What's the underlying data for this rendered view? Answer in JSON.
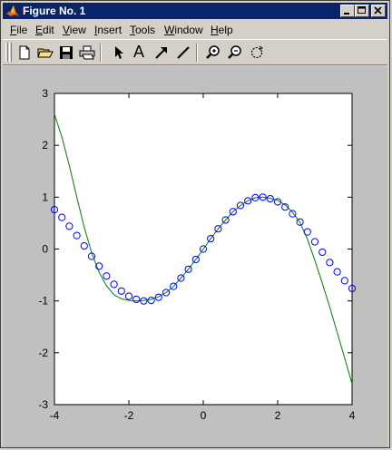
{
  "window": {
    "title": "Figure No. 1"
  },
  "menu": {
    "items": [
      {
        "label": "File",
        "underline": "F",
        "rest": "ile"
      },
      {
        "label": "Edit",
        "underline": "E",
        "rest": "dit"
      },
      {
        "label": "View",
        "underline": "V",
        "rest": "iew"
      },
      {
        "label": "Insert",
        "underline": "I",
        "rest": "nsert"
      },
      {
        "label": "Tools",
        "underline": "T",
        "rest": "ools"
      },
      {
        "label": "Window",
        "underline": "W",
        "rest": "indow"
      },
      {
        "label": "Help",
        "underline": "H",
        "rest": "elp"
      }
    ]
  },
  "toolbar": {
    "tools": [
      "new-file-icon",
      "open-folder-icon",
      "save-icon",
      "print-icon",
      "select-arrow-icon",
      "insert-text-icon",
      "insert-arrow-icon",
      "insert-line-icon",
      "zoom-in-icon",
      "zoom-out-icon",
      "rotate-3d-icon"
    ],
    "text_tool_glyph": "A"
  },
  "colors": {
    "titlebar": "#0a246a",
    "curve": "#008000",
    "markers": "#0000ff",
    "figure_bg": "#c0c0c0",
    "axes_bg": "#ffffff"
  },
  "chart_data": {
    "type": "line",
    "title": "",
    "xlabel": "",
    "ylabel": "",
    "xlim": [
      -4,
      4
    ],
    "ylim": [
      -3,
      3
    ],
    "xticks": [
      "-4",
      "-2",
      "0",
      "2",
      "4"
    ],
    "yticks": [
      "-3",
      "-2",
      "-1",
      "0",
      "1",
      "2",
      "3"
    ],
    "grid": false,
    "series": [
      {
        "style": "solid-line",
        "color": "#008000",
        "x": [
          -4,
          -3.8,
          -3.6,
          -3.4,
          -3.2,
          -3,
          -2.8,
          -2.6,
          -2.4,
          -2.2,
          -2,
          -1.8,
          -1.6,
          -1.4,
          -1.2,
          -1,
          -0.8,
          -0.6,
          -0.4,
          -0.2,
          0,
          0.2,
          0.4,
          0.6,
          0.8,
          1,
          1.2,
          1.4,
          1.6,
          1.8,
          2,
          2.2,
          2.4,
          2.6,
          2.8,
          3,
          3.2,
          3.4,
          3.6,
          3.8,
          4
        ],
        "y": [
          2.6,
          2.16,
          1.61,
          1.0,
          0.42,
          -0.07,
          -0.45,
          -0.71,
          -0.88,
          -0.96,
          -0.99,
          -1.0,
          -0.99,
          -0.97,
          -0.92,
          -0.84,
          -0.72,
          -0.56,
          -0.39,
          -0.2,
          0.0,
          0.2,
          0.39,
          0.56,
          0.72,
          0.84,
          0.93,
          0.99,
          1.0,
          0.98,
          0.94,
          0.85,
          0.71,
          0.51,
          0.19,
          -0.22,
          -0.66,
          -1.12,
          -1.61,
          -2.1,
          -2.6
        ]
      },
      {
        "style": "circle-markers",
        "color": "#0000ff",
        "x": [
          -4,
          -3.8,
          -3.6,
          -3.4,
          -3.2,
          -3,
          -2.8,
          -2.6,
          -2.4,
          -2.2,
          -2,
          -1.8,
          -1.6,
          -1.4,
          -1.2,
          -1,
          -0.8,
          -0.6,
          -0.4,
          -0.2,
          0,
          0.2,
          0.4,
          0.6,
          0.8,
          1,
          1.2,
          1.4,
          1.6,
          1.8,
          2,
          2.2,
          2.4,
          2.6,
          2.8,
          3,
          3.2,
          3.4,
          3.6,
          3.8,
          4
        ],
        "y": [
          0.76,
          0.61,
          0.44,
          0.26,
          0.06,
          -0.14,
          -0.33,
          -0.52,
          -0.68,
          -0.81,
          -0.91,
          -0.97,
          -1.0,
          -0.99,
          -0.93,
          -0.84,
          -0.72,
          -0.56,
          -0.39,
          -0.2,
          0.0,
          0.2,
          0.39,
          0.56,
          0.72,
          0.84,
          0.93,
          0.99,
          1.0,
          0.97,
          0.91,
          0.81,
          0.68,
          0.52,
          0.33,
          0.14,
          -0.06,
          -0.26,
          -0.44,
          -0.61,
          -0.76
        ]
      }
    ]
  }
}
